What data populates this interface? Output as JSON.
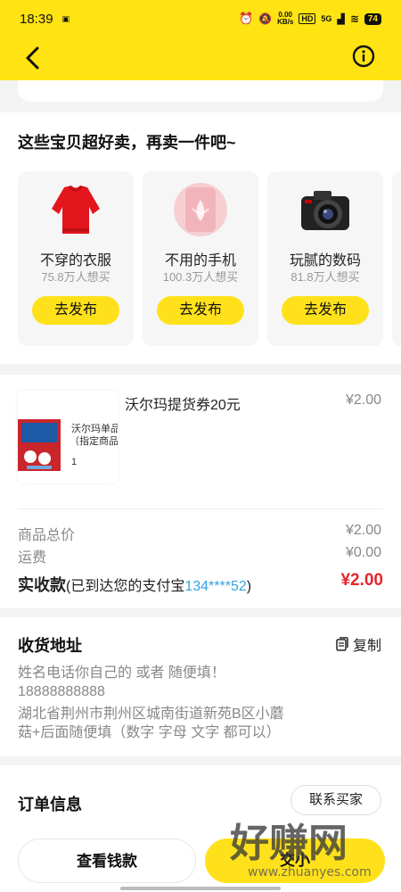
{
  "status_bar": {
    "time": "18:39",
    "net_speed_value": "0.00",
    "net_speed_unit": "KB/s",
    "hd": "HD",
    "signal": "5G",
    "battery": "74"
  },
  "icons": {
    "back": "chevron-left-icon",
    "info": "info-circle-icon",
    "copy": "copy-icon"
  },
  "colors": {
    "brand_yellow": "#ffe312",
    "button_yellow": "#ffe11b",
    "amount_red": "#e6252c",
    "account_blue": "#35a3e0"
  },
  "sell_section": {
    "title": "这些宝贝超好卖，再卖一件吧~",
    "items": [
      {
        "name": "不穿的衣服",
        "want": "75.8万人想买",
        "button": "去发布"
      },
      {
        "name": "不用的手机",
        "want": "100.3万人想买",
        "button": "去发布"
      },
      {
        "name": "玩腻的数码",
        "want": "81.8万人想买",
        "button": "去发布"
      }
    ]
  },
  "order": {
    "product_title": "沃尔玛提货券20元",
    "product_price": "¥2.00",
    "thumb_text_line1": "沃尔玛单品",
    "thumb_text_line2": "（指定商品",
    "thumb_qty": "1",
    "total_label": "商品总价",
    "total_value": "¥2.00",
    "shipping_label": "运费",
    "shipping_value": "¥0.00",
    "received_label": "实收款",
    "received_note_prefix": "(已到达您的支付宝",
    "received_account": "134****52",
    "received_note_suffix": ")",
    "received_amount": "¥2.00"
  },
  "address": {
    "title": "收货地址",
    "copy_label": "复制",
    "name_line": "姓名电话你自己的 或者 随便填！",
    "phone": "18888888888",
    "address_line1": "湖北省荆州市荆州区城南街道新苑B区小蘑",
    "address_line2": "菇+后面随便填（数字 字母 文字 都可以）"
  },
  "order_info": {
    "title": "订单信息",
    "contact_button": "联系买家"
  },
  "bottom_bar": {
    "view_money": "查看钱款",
    "second_button": "交小"
  },
  "watermark": {
    "cn": "好赚网",
    "url": "www.zhuanyes.com"
  }
}
